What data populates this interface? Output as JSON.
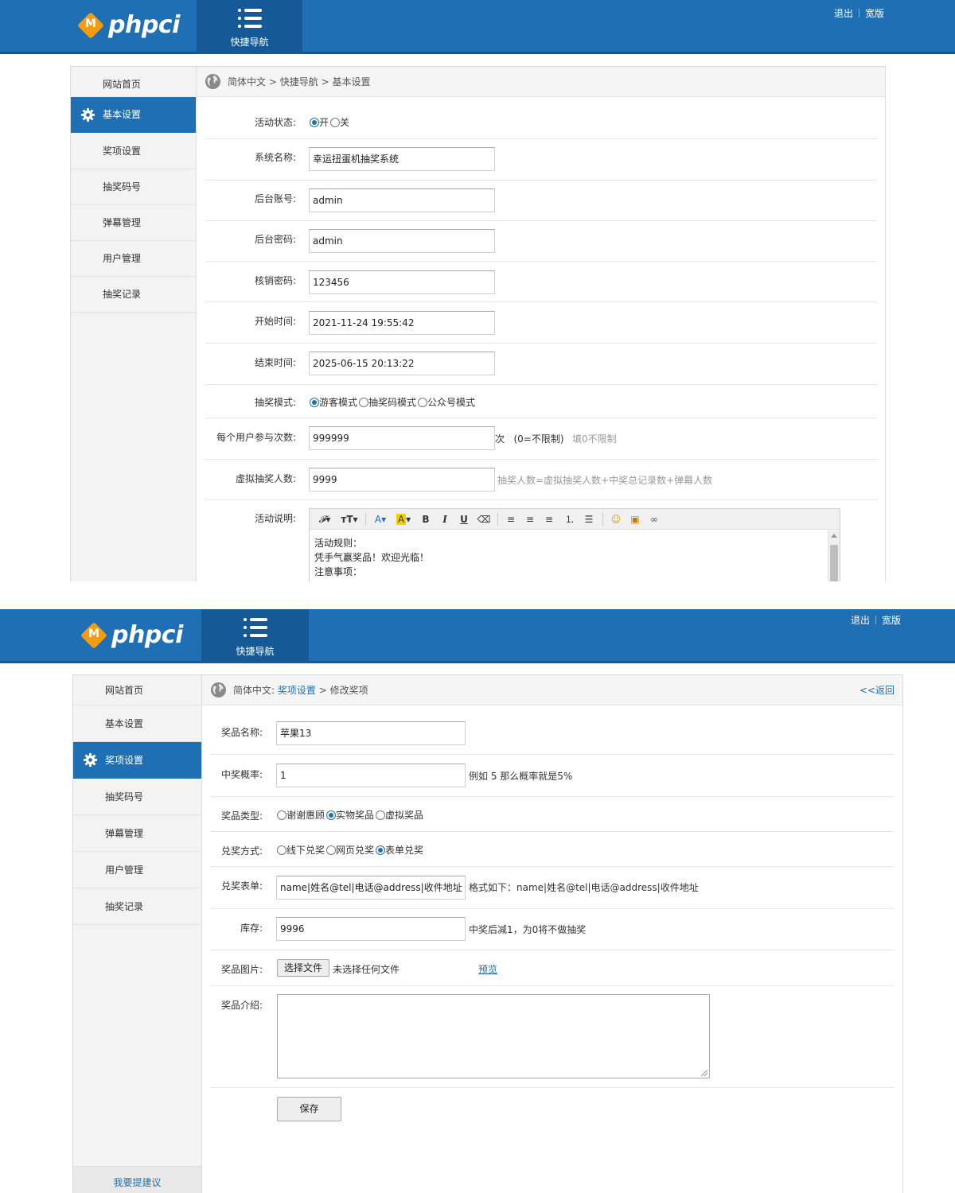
{
  "header": {
    "logo_text": "phpci",
    "logo_mark": "M",
    "quicknav_label": "快捷导航",
    "logout": "退出",
    "wide": "宽版"
  },
  "sidebar": {
    "items": [
      "网站首页",
      "基本设置",
      "奖项设置",
      "抽奖码号",
      "弹幕管理",
      "用户管理",
      "抽奖记录"
    ],
    "suggest": "我要提建议"
  },
  "page1": {
    "breadcrumb": {
      "root": "简体中文",
      "sep": ">",
      "parent": "快捷导航",
      "current": "基本设置"
    },
    "labels": {
      "status": "活动状态:",
      "sysname": "系统名称:",
      "account": "后台账号:",
      "password": "后台密码:",
      "verify": "核销密码:",
      "start": "开始时间:",
      "end": "结束时间:",
      "mode": "抽奖模式:",
      "times": "每个用户参与次数:",
      "virtual": "虚拟抽奖人数:",
      "desc": "活动说明:"
    },
    "status_options": [
      "开",
      "关"
    ],
    "values": {
      "sysname": "幸运扭蛋机抽奖系统",
      "account": "admin",
      "password": "admin",
      "verify": "123456",
      "start": "2021-11-24 19:55:42",
      "end": "2025-06-15 20:13:22",
      "times": "999999",
      "virtual": "9999"
    },
    "mode_options": [
      "游客模式",
      "抽奖码模式",
      "公众号模式"
    ],
    "times_unit": "次",
    "times_note": "(0=不限制)",
    "times_hint": "填0不限制",
    "virtual_hint": "抽奖人数=虚拟抽奖人数+中奖总记录数+弹幕人数",
    "editor": {
      "lines": [
        "活动规则：",
        "凭手气赢奖品！欢迎光临！",
        "注意事项："
      ]
    }
  },
  "page2": {
    "breadcrumb": {
      "root": "简体中文:",
      "parent": "奖项设置",
      "sep": ">",
      "current": "修改奖项",
      "back": "<<返回"
    },
    "labels": {
      "name": "奖品名称:",
      "prob": "中奖概率:",
      "type": "奖品类型:",
      "redeem": "兑奖方式:",
      "form": "兑奖表单:",
      "stock": "库存:",
      "image": "奖品图片:",
      "intro": "奖品介绍:"
    },
    "values": {
      "name": "苹果13",
      "prob": "1",
      "form": "name|姓名@tel|电话@address|收件地址",
      "stock": "9996"
    },
    "prob_hint": "例如 5 那么概率就是5%",
    "type_options": [
      "谢谢惠顾",
      "实物奖品",
      "虚拟奖品"
    ],
    "redeem_options": [
      "线下兑奖",
      "网页兑奖",
      "表单兑奖"
    ],
    "form_hint": "格式如下：name|姓名@tel|电话@address|收件地址",
    "stock_hint": "中奖后减1，为0将不做抽奖",
    "file_button": "选择文件",
    "file_status": "未选择任何文件",
    "preview": "预览",
    "save": "保存"
  }
}
